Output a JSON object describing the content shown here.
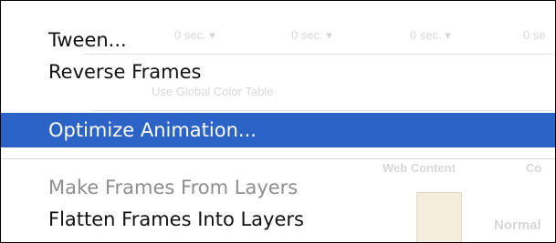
{
  "menu": {
    "items": [
      {
        "label": "Tween...",
        "state": "normal"
      },
      {
        "label": "Reverse Frames",
        "state": "normal"
      },
      {
        "label": "Optimize Animation...",
        "state": "selected"
      },
      {
        "label": "Make Frames From Layers",
        "state": "disabled"
      },
      {
        "label": "Flatten Frames Into Layers",
        "state": "normal"
      }
    ]
  },
  "background_ui": {
    "delay_labels": [
      "0 sec. ▾",
      "0 sec. ▾",
      "0 sec. ▾",
      "0 se"
    ],
    "color_table_label": "Use Global Color Table",
    "web_content_label": "Web Content",
    "color_label": "Co",
    "normal_label": "Normal"
  },
  "colors": {
    "selection": "#2b63c6",
    "disabled_text": "#8e8e8e"
  }
}
